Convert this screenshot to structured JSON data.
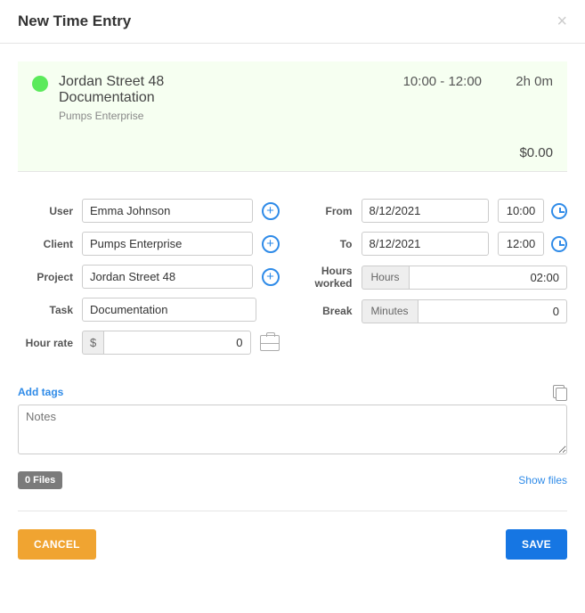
{
  "header": {
    "title": "New Time Entry"
  },
  "summary": {
    "project": "Jordan Street 48",
    "task": "Documentation",
    "client": "Pumps Enterprise",
    "time_range": "10:00 - 12:00",
    "duration": "2h 0m",
    "amount": "$0.00",
    "dot_color": "#5bea5b"
  },
  "left": {
    "user": {
      "label": "User",
      "value": "Emma Johnson"
    },
    "client": {
      "label": "Client",
      "value": "Pumps Enterprise"
    },
    "project": {
      "label": "Project",
      "value": "Jordan Street 48"
    },
    "task": {
      "label": "Task",
      "value": "Documentation"
    },
    "hour_rate": {
      "label": "Hour rate",
      "prefix": "$",
      "value": "0"
    }
  },
  "right": {
    "from": {
      "label": "From",
      "date": "8/12/2021",
      "time": "10:00"
    },
    "to": {
      "label": "To",
      "date": "8/12/2021",
      "time": "12:00"
    },
    "hours_worked": {
      "label": "Hours worked",
      "prefix": "Hours",
      "value": "02:00"
    },
    "break": {
      "label": "Break",
      "prefix": "Minutes",
      "value": "0"
    }
  },
  "tags": {
    "add_label": "Add tags"
  },
  "notes": {
    "placeholder": "Notes",
    "value": ""
  },
  "files": {
    "badge": "0 Files",
    "show_label": "Show files"
  },
  "footer": {
    "cancel": "CANCEL",
    "save": "SAVE"
  }
}
